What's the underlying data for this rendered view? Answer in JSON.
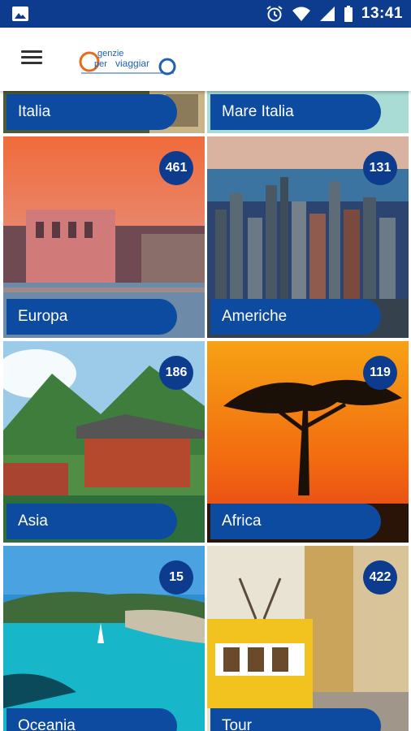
{
  "status_bar": {
    "time": "13:41",
    "icons": [
      "image-icon",
      "alarm-icon",
      "wifi-icon",
      "signal-icon",
      "battery-icon"
    ]
  },
  "app_bar": {
    "menu_icon": "hamburger-icon",
    "logo_text": "agenzie per viaggiare"
  },
  "colors": {
    "primary": "#0d3b8e",
    "label_bg": "#0d4ba0"
  },
  "tiles": [
    {
      "label": "Italia",
      "count": ""
    },
    {
      "label": "Mare Italia",
      "count": ""
    },
    {
      "label": "Europa",
      "count": "461"
    },
    {
      "label": "Americhe",
      "count": "131"
    },
    {
      "label": "Asia",
      "count": "186"
    },
    {
      "label": "Africa",
      "count": "119"
    },
    {
      "label": "Oceania",
      "count": "15"
    },
    {
      "label": "Tour",
      "count": "422"
    }
  ]
}
